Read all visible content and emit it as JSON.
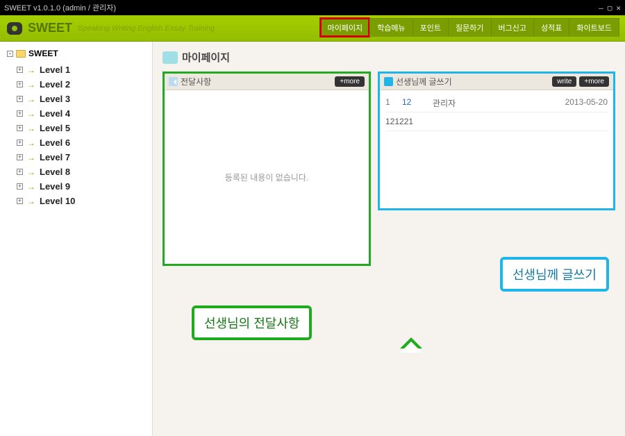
{
  "window": {
    "title": "SWEET v1.0.1.0 (admin / 관리자)"
  },
  "brand": {
    "title": "SWEET",
    "subtitle": "Speaking Writing English Essay Training"
  },
  "top_nav": {
    "items": [
      {
        "label": "마이페이지",
        "highlight": true
      },
      {
        "label": "학습메뉴"
      },
      {
        "label": "포인트"
      },
      {
        "label": "질문하기"
      },
      {
        "label": "버그신고"
      },
      {
        "label": "성적표"
      },
      {
        "label": "화이트보드"
      }
    ]
  },
  "sidebar": {
    "root": "SWEET",
    "items": [
      {
        "label": "Level 1"
      },
      {
        "label": "Level 2"
      },
      {
        "label": "Level 3"
      },
      {
        "label": "Level 4"
      },
      {
        "label": "Level 5"
      },
      {
        "label": "Level 6"
      },
      {
        "label": "Level 7"
      },
      {
        "label": "Level 8"
      },
      {
        "label": "Level 9"
      },
      {
        "label": "Level 10"
      }
    ]
  },
  "page": {
    "title": "마이페이지",
    "left_panel": {
      "title": "전달사항",
      "more": "+more",
      "empty": "등록된 내용이 없습니다."
    },
    "right_panel": {
      "title": "선생님께 글쓰기",
      "write": "write",
      "more": "+more",
      "rows": [
        {
          "num": "1",
          "title": "12",
          "author": "관리자",
          "date": "2013-05-20"
        }
      ],
      "time": "121221"
    },
    "callouts": {
      "green": "선생님의 전달사항",
      "cyan": "선생님께 글쓰기"
    }
  }
}
